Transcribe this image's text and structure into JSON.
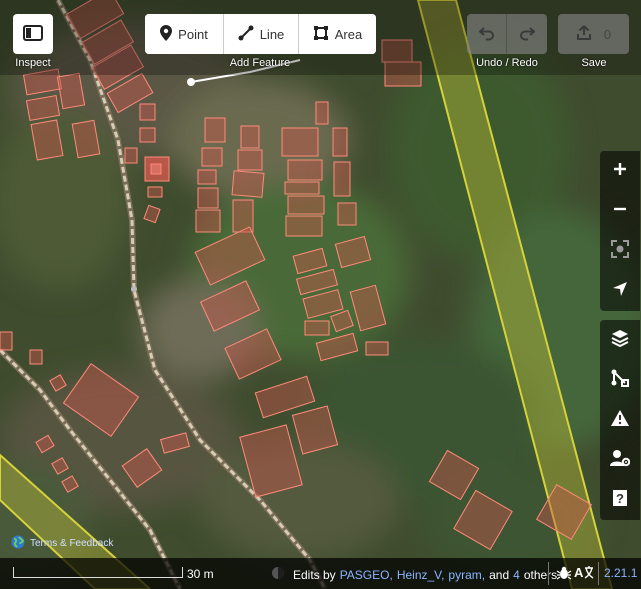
{
  "toolbar": {
    "inspect_label": "Inspect",
    "add_feature_label": "Add Feature",
    "point_label": "Point",
    "line_label": "Line",
    "area_label": "Area",
    "undo_redo_label": "Undo / Redo",
    "save_label": "Save",
    "save_count": "0"
  },
  "side_controls": [
    "zoom-in",
    "zoom-out",
    "zoom-to-selection",
    "geolocate",
    "background",
    "map-data",
    "issues",
    "preferences",
    "help"
  ],
  "footer": {
    "terms_link": "Terms & Feedback",
    "scale_label": "30 m",
    "edits_prefix": "Edits by",
    "contributor_1": "PASGEO,",
    "contributor_2": "Heinz_V,",
    "contributor_3": "pyram,",
    "and_text": "and",
    "others_count": "4",
    "others_text": "others",
    "version": "2.21.1"
  },
  "colors": {
    "building_fill": "#c8574c",
    "building_stroke": "#ff8a7a",
    "boundary": "#d6d23a",
    "path": "#cfc4aa",
    "link": "#8cb4ff"
  }
}
